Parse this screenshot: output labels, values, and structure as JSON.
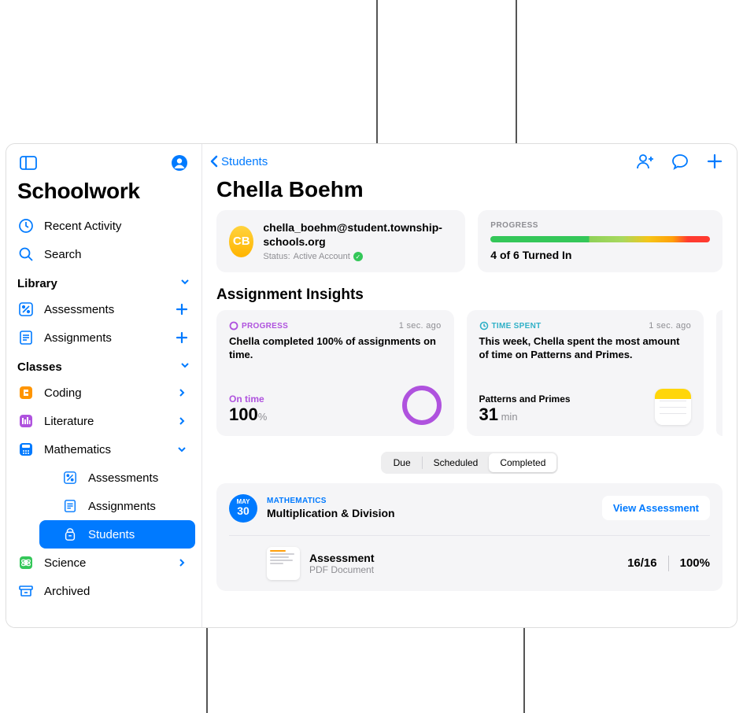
{
  "app": {
    "title": "Schoolwork"
  },
  "sidebar": {
    "top_items": [
      {
        "label": "Recent Activity"
      },
      {
        "label": "Search"
      }
    ],
    "sections": {
      "library": {
        "label": "Library",
        "items": [
          {
            "label": "Assessments"
          },
          {
            "label": "Assignments"
          }
        ]
      },
      "classes": {
        "label": "Classes",
        "items": [
          {
            "label": "Coding"
          },
          {
            "label": "Literature"
          },
          {
            "label": "Mathematics",
            "sub": [
              {
                "label": "Assessments"
              },
              {
                "label": "Assignments"
              },
              {
                "label": "Students"
              }
            ]
          },
          {
            "label": "Science"
          },
          {
            "label": "Archived"
          }
        ]
      }
    }
  },
  "back_label": "Students",
  "student": {
    "name": "Chella Boehm",
    "initials": "CB",
    "email": "chella_boehm@student.township-schools.org",
    "status_prefix": "Status:",
    "status": "Active Account"
  },
  "progress": {
    "label": "PROGRESS",
    "text": "4 of 6 Turned In"
  },
  "insights": {
    "title": "Assignment Insights",
    "cards": [
      {
        "tag": "PROGRESS",
        "ts": "1 sec. ago",
        "headline": "Chella completed 100% of assignments on time.",
        "stat_label": "On time",
        "stat_value": "100",
        "stat_unit": "%"
      },
      {
        "tag": "TIME SPENT",
        "ts": "1 sec. ago",
        "headline": "This week, Chella spent the most amount of time on Patterns and Primes.",
        "stat_label": "Patterns and Primes",
        "stat_value": "31",
        "stat_unit": " min"
      }
    ]
  },
  "segments": {
    "due": "Due",
    "scheduled": "Scheduled",
    "completed": "Completed"
  },
  "assignment": {
    "month": "MAY",
    "day": "30",
    "subject": "MATHEMATICS",
    "title": "Multiplication & Division",
    "view_label": "View Assessment",
    "doc_name": "Assessment",
    "doc_type": "PDF Document",
    "score": "16/16",
    "percent": "100%"
  }
}
